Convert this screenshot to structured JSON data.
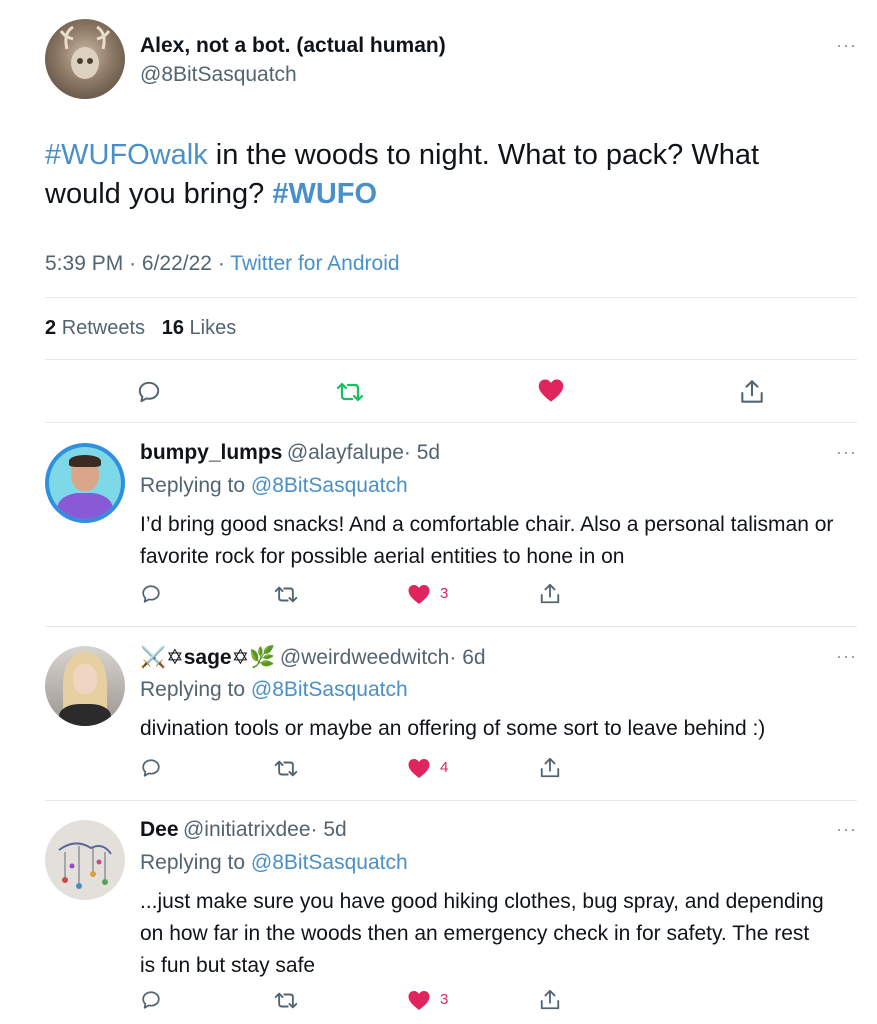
{
  "tweet": {
    "author_name": "Alex, not a bot. (actual human)",
    "author_handle": "@8BitSasquatch",
    "hashtag1": "#WUFOwalk",
    "text_part1": " in the woods to night. What to pack? What would you bring? ",
    "hashtag2": "#WUFO",
    "time": "5:39 PM",
    "date": "6/22/22",
    "sep": "·",
    "source": "Twitter for Android",
    "retweet_count": "2",
    "retweet_label": "Retweets",
    "like_count": "16",
    "like_label": "Likes"
  },
  "replies": [
    {
      "name": "bumpy_lumps",
      "handle": "@alayfalupe",
      "age": "· 5d",
      "replying_label": "Replying to",
      "replying_to": "@8BitSasquatch",
      "body": "I’d bring good snacks! And a comfortable chair. Also a personal talisman or favorite rock for possible aerial entities to hone in on",
      "likes": "3"
    },
    {
      "name": "⚔️✡sage✡🌿",
      "handle": "@weirdweedwitch",
      "age": "· 6d",
      "replying_label": "Replying to",
      "replying_to": "@8BitSasquatch",
      "body": "divination tools or maybe an offering of some sort to leave behind :)",
      "likes": "4"
    },
    {
      "name": "Dee",
      "handle": "@initiatrixdee",
      "age": "· 5d",
      "replying_label": "Replying to",
      "replying_to": "@8BitSasquatch",
      "body": "...just make sure you have good hiking clothes, bug spray, and depending on how far in the woods then an emergency check in for safety. The rest is fun but stay safe",
      "likes": "3"
    }
  ],
  "icons": {
    "more": "more-horizontal-icon",
    "reply": "reply-icon",
    "retweet": "retweet-icon",
    "like": "heart-icon",
    "share": "share-icon"
  },
  "colors": {
    "link": "#4a90c8",
    "retweet_active": "#17bf63",
    "like_active": "#e0245e",
    "muted": "#536471"
  }
}
